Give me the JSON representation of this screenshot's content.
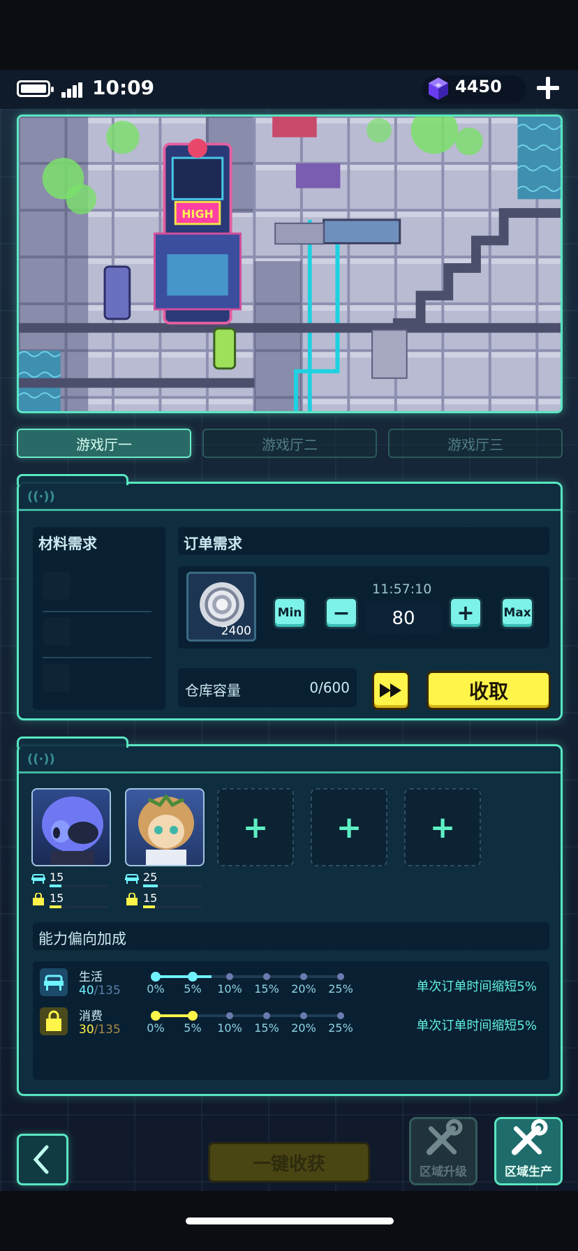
{
  "status_bar": {
    "time": "10:09",
    "gems": "4450"
  },
  "map": {
    "sign": "HIGH"
  },
  "hall_tabs": [
    "游戏厅一",
    "游戏厅二",
    "游戏厅三"
  ],
  "production": {
    "materials_title": "材料需求",
    "order_title": "订单需求",
    "item_count": "2400",
    "timer": "11:57:10",
    "min_label": "Min",
    "max_label": "Max",
    "quantity": "80",
    "storage_label": "仓库容量",
    "storage_value": "0/600",
    "collect_label": "收取"
  },
  "staff": {
    "workers": [
      {
        "stat1": "15",
        "stat2": "15",
        "stat1_fill": 0.2,
        "stat2_fill": 0.2
      },
      {
        "stat1": "25",
        "stat2": "15",
        "stat1_fill": 0.25,
        "stat2_fill": 0.2
      }
    ],
    "empty_slot_icon": "+",
    "bonus_title": "能力偏向加成",
    "bonuses": [
      {
        "name": "生活",
        "current": "40",
        "max": "/135",
        "level_fraction": 0.3,
        "effect": "单次订单时间缩短5%",
        "color": "#6ff3ff"
      },
      {
        "name": "消费",
        "current": "30",
        "max": "/135",
        "level_fraction": 0.22,
        "effect": "单次订单时间缩短5%",
        "color": "#fff44a"
      }
    ],
    "ticks": [
      "0%",
      "5%",
      "10%",
      "15%",
      "20%",
      "25%"
    ]
  },
  "bottom": {
    "harvest_label": "一键收获",
    "upgrade_label": "区域升级",
    "produce_label": "区域生产"
  },
  "colors": {
    "accent": "#59e6c2",
    "yellow": "#fff44a",
    "cyan": "#7cf2e8"
  }
}
